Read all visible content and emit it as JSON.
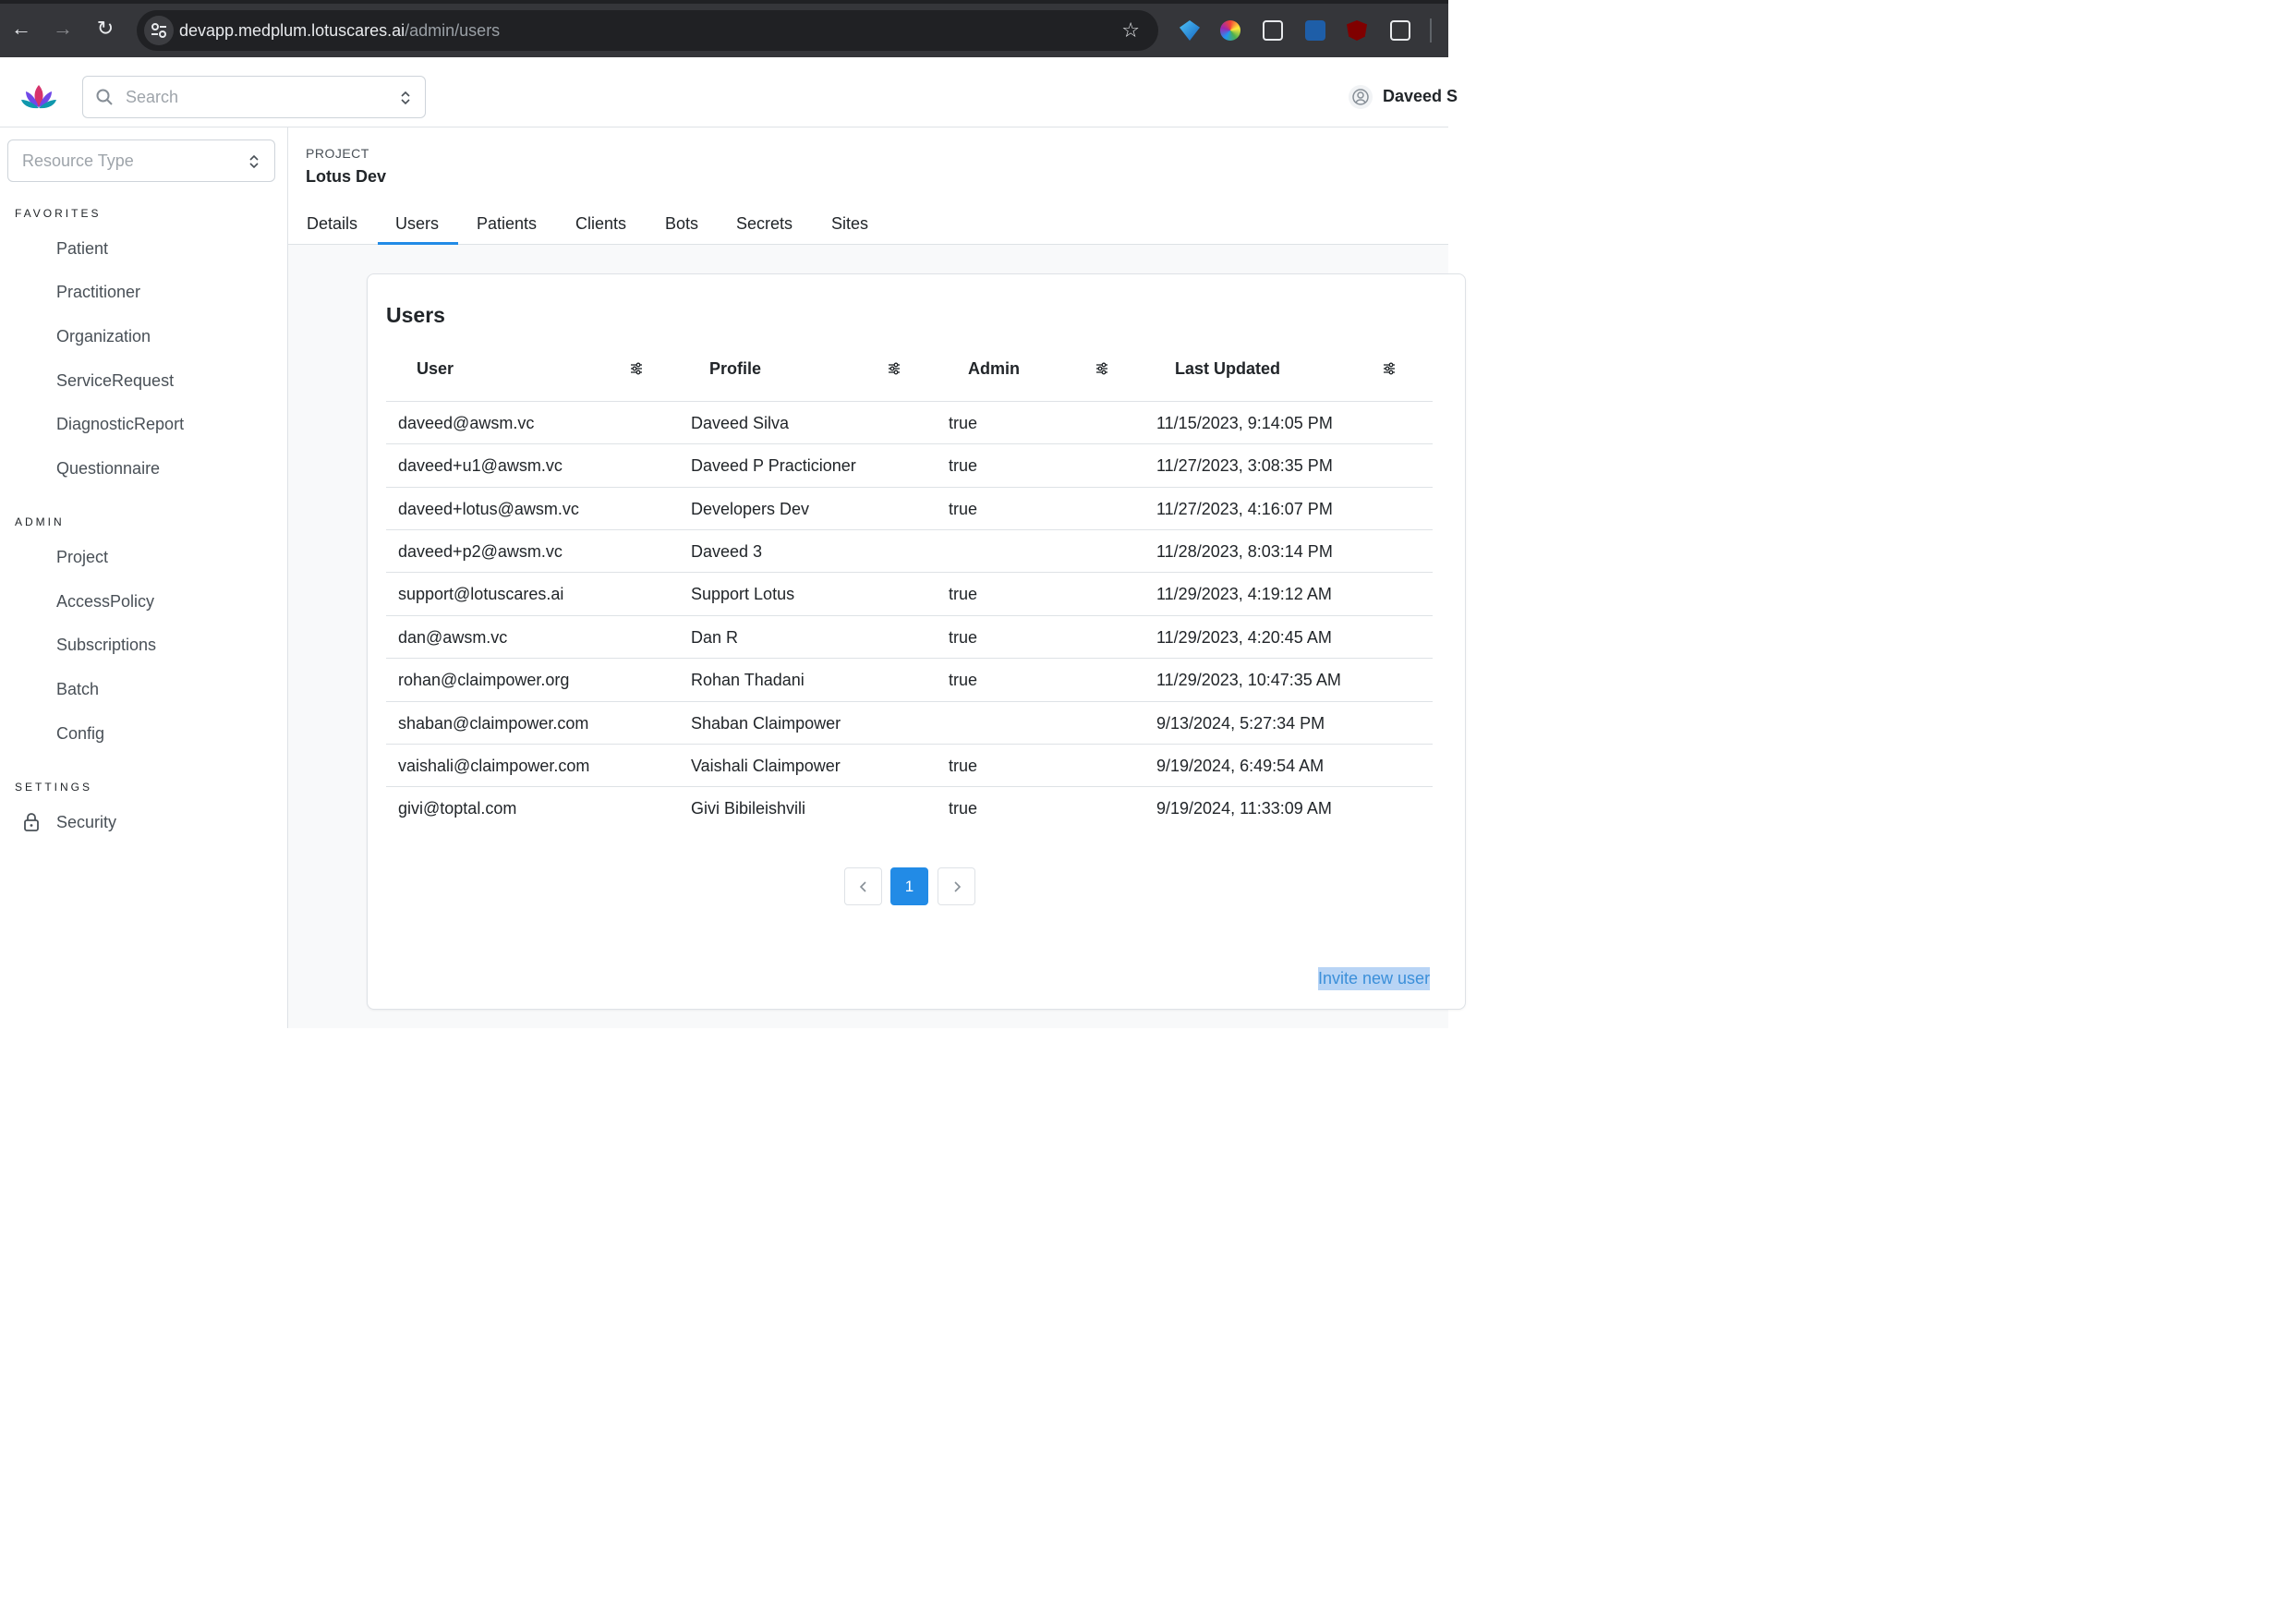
{
  "browser": {
    "url_host": "devapp.medplum.lotuscares.ai",
    "url_path": "/admin/users"
  },
  "header": {
    "search_placeholder": "Search",
    "user_name": "Daveed S"
  },
  "sidebar": {
    "resource_type_placeholder": "Resource Type",
    "favorites_label": "FAVORITES",
    "favorites": [
      "Patient",
      "Practitioner",
      "Organization",
      "ServiceRequest",
      "DiagnosticReport",
      "Questionnaire"
    ],
    "admin_label": "ADMIN",
    "admin": [
      "Project",
      "AccessPolicy",
      "Subscriptions",
      "Batch",
      "Config"
    ],
    "settings_label": "SETTINGS",
    "settings": [
      "Security"
    ]
  },
  "project": {
    "label": "PROJECT",
    "name": "Lotus Dev"
  },
  "tabs": [
    "Details",
    "Users",
    "Patients",
    "Clients",
    "Bots",
    "Secrets",
    "Sites"
  ],
  "active_tab": "Users",
  "users_card": {
    "title": "Users",
    "columns": [
      "User",
      "Profile",
      "Admin",
      "Last Updated"
    ],
    "rows": [
      {
        "user": "daveed@awsm.vc",
        "profile": "Daveed Silva",
        "admin": "true",
        "updated": "11/15/2023, 9:14:05 PM"
      },
      {
        "user": "daveed+u1@awsm.vc",
        "profile": "Daveed P Practicioner",
        "admin": "true",
        "updated": "11/27/2023, 3:08:35 PM"
      },
      {
        "user": "daveed+lotus@awsm.vc",
        "profile": "Developers Dev",
        "admin": "true",
        "updated": "11/27/2023, 4:16:07 PM"
      },
      {
        "user": "daveed+p2@awsm.vc",
        "profile": "Daveed 3",
        "admin": "",
        "updated": "11/28/2023, 8:03:14 PM"
      },
      {
        "user": "support@lotuscares.ai",
        "profile": "Support Lotus",
        "admin": "true",
        "updated": "11/29/2023, 4:19:12 AM"
      },
      {
        "user": "dan@awsm.vc",
        "profile": "Dan R",
        "admin": "true",
        "updated": "11/29/2023, 4:20:45 AM"
      },
      {
        "user": "rohan@claimpower.org",
        "profile": "Rohan Thadani",
        "admin": "true",
        "updated": "11/29/2023, 10:47:35 AM"
      },
      {
        "user": "shaban@claimpower.com",
        "profile": "Shaban Claimpower",
        "admin": "",
        "updated": "9/13/2024, 5:27:34 PM"
      },
      {
        "user": "vaishali@claimpower.com",
        "profile": "Vaishali Claimpower",
        "admin": "true",
        "updated": "9/19/2024, 6:49:54 AM"
      },
      {
        "user": "givi@toptal.com",
        "profile": "Givi Bibileishvili",
        "admin": "true",
        "updated": "9/19/2024, 11:33:09 AM"
      }
    ],
    "current_page": "1",
    "invite_label": "Invite new user"
  },
  "colors": {
    "accent": "#228be6",
    "chrome": "#35363a"
  }
}
